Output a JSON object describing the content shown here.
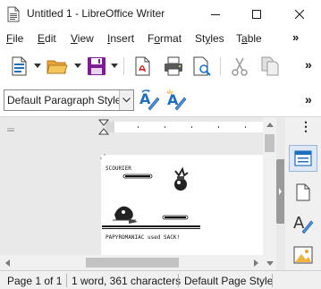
{
  "window": {
    "title": "Untitled 1 - LibreOffice Writer",
    "controls": [
      "minimize-icon",
      "maximize-icon",
      "close-icon"
    ]
  },
  "menubar": {
    "items": [
      {
        "label": "File",
        "mnemonic": "F",
        "rest": "ile"
      },
      {
        "label": "Edit",
        "mnemonic": "E",
        "rest": "dit"
      },
      {
        "label": "View",
        "mnemonic": "V",
        "rest": "iew"
      },
      {
        "label": "Insert",
        "mnemonic": "I",
        "rest": "nsert"
      },
      {
        "label": "Format",
        "mnemonic": "o",
        "pre": "F",
        "rest": "rmat"
      },
      {
        "label": "Styles",
        "mnemonic": "y",
        "pre": "St",
        "rest": "les"
      },
      {
        "label": "Table",
        "mnemonic": "a",
        "pre": "T",
        "rest": "ble"
      }
    ],
    "overflow": "»"
  },
  "toolbar": {
    "icons": [
      "new-document-icon",
      "open-folder-icon",
      "save-icon",
      "export-pdf-icon",
      "print-icon",
      "print-preview-icon",
      "cut-icon",
      "copy-icon"
    ],
    "overflow": "»"
  },
  "formatting_toolbar": {
    "paragraph_style": "Default Paragraph Style",
    "icons": [
      "update-style-icon",
      "new-style-icon"
    ],
    "overflow": "»"
  },
  "document": {
    "image_description_text": {
      "opponent_name": "SCOURIER",
      "battle_message": "PAPYROMANIAC used SACK!"
    }
  },
  "sidebar": {
    "overflow": "⋮",
    "buttons": [
      "properties-icon",
      "page-icon",
      "styles-icon",
      "gallery-icon"
    ]
  },
  "statusbar": {
    "page": "Page 1 of 1",
    "words": "1 word, 361 characters",
    "page_style": "Default Page Style"
  },
  "colors": {
    "accent_blue": "#1e6fbf",
    "folder_yellow": "#f0b43c",
    "save_purple": "#7a1f8f",
    "close_red": "#e81123"
  }
}
